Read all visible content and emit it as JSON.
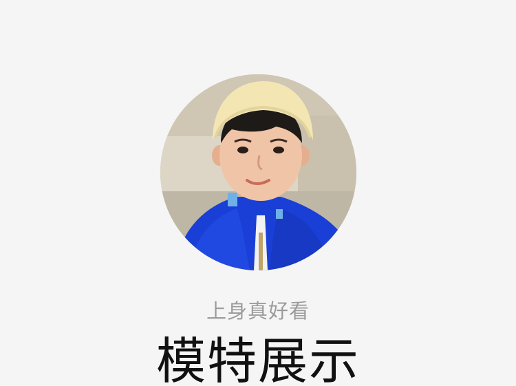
{
  "section": {
    "subtitle": "上身真好看",
    "title": "模特展示"
  },
  "avatar": {
    "icon": "child-model-photo"
  },
  "colors": {
    "background": "#f5f5f5",
    "subtitle": "#9b9b9b",
    "title": "#111111",
    "jacket": "#1a3fd6",
    "beanie": "#f3e6b3"
  }
}
